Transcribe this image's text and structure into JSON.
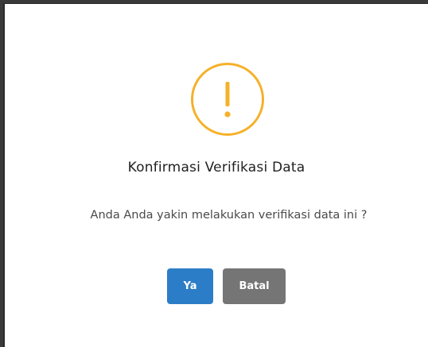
{
  "dialog": {
    "icon": "exclamation-circle-icon",
    "accent_color": "#f5b12a",
    "title": "Konfirmasi Verifikasi Data",
    "message": "Anda Anda yakin melakukan verifikasi data ini ?",
    "confirm_label": "Ya",
    "confirm_color": "#2c7dc7",
    "cancel_label": "Batal",
    "cancel_color": "#757575"
  }
}
